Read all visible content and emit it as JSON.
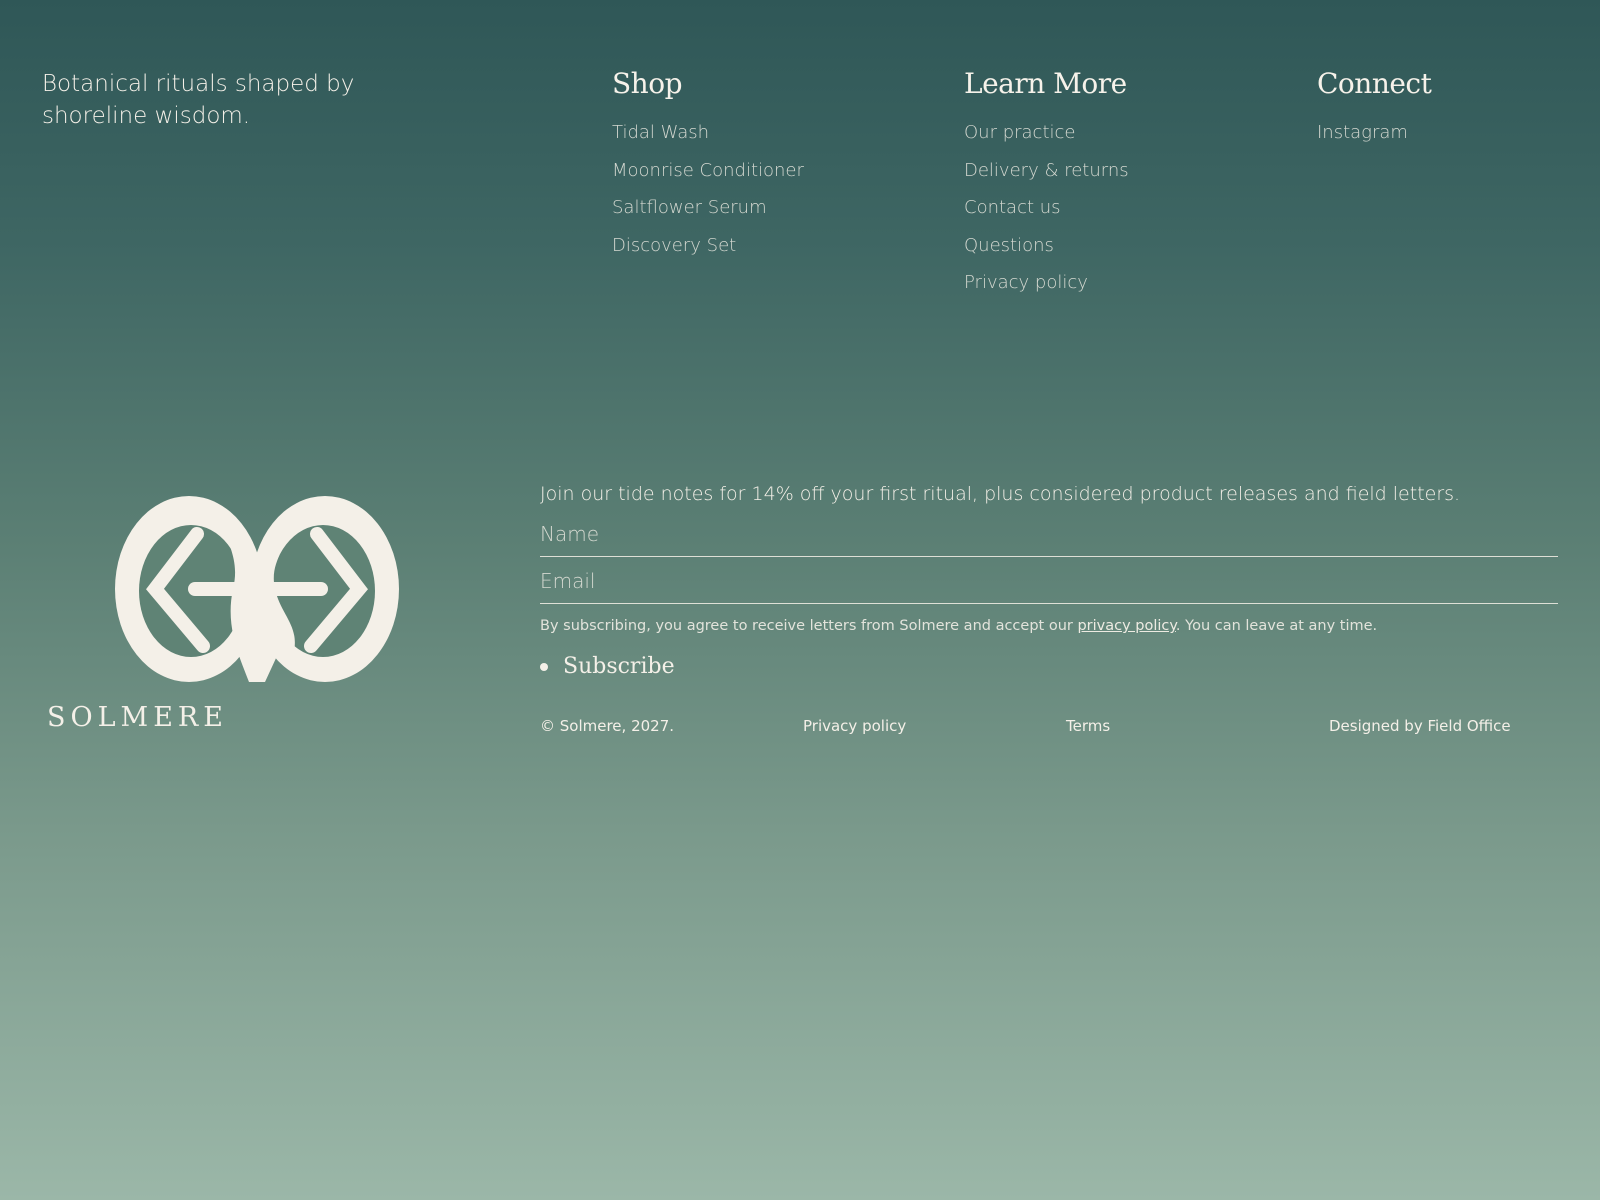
{
  "brand": {
    "tagline": "Botanical rituals shaped by shoreline wisdom.",
    "wordmark": "SOLMERE",
    "logo_icon": "twin-circle-arrows-logo"
  },
  "nav": {
    "shop": {
      "heading": "Shop",
      "links": [
        "Tidal Wash",
        "Moonrise Conditioner",
        "Saltflower Serum",
        "Discovery Set"
      ]
    },
    "learn_more": {
      "heading": "Learn More",
      "links": [
        "Our practice",
        "Delivery & returns",
        "Contact us",
        "Questions",
        "Privacy policy"
      ]
    },
    "connect": {
      "heading": "Connect",
      "links": [
        "Instagram"
      ]
    }
  },
  "newsletter": {
    "intro": "Join our tide notes for 14% off your first ritual, plus considered product releases and field letters.",
    "name_placeholder": "Name",
    "email_placeholder": "Email",
    "consent_prefix": "By subscribing, you agree to receive letters from Solmere and accept our ",
    "consent_link": "privacy policy",
    "consent_suffix": ". You can leave at any time.",
    "subscribe_label": "Subscribe"
  },
  "legal": {
    "copyright": "© Solmere, 2027.",
    "privacy": "Privacy policy",
    "terms": "Terms",
    "designed_by": "Designed by Field Office"
  },
  "colors": {
    "background_top": "#2f5757",
    "background_bottom": "#9bb7a8",
    "foreground": "#f4f0e8"
  }
}
